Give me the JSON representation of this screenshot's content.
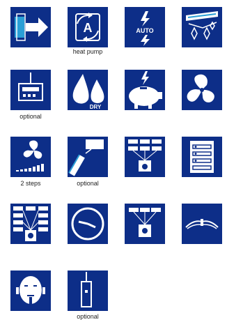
{
  "colors": {
    "tile": "#0d2e88",
    "accent": "#2a9fd6",
    "icon": "#ffffff"
  },
  "icons": [
    {
      "name": "airflow-arrow-icon",
      "caption": ""
    },
    {
      "name": "heat-pump-auto-icon",
      "caption": "heat pump",
      "text": "A"
    },
    {
      "name": "auto-lightning-icon",
      "caption": "",
      "text": "AUTO"
    },
    {
      "name": "ionizer-filter-icon",
      "caption": ""
    },
    {
      "name": "remote-control-icon",
      "caption": "optional"
    },
    {
      "name": "dry-mode-icon",
      "caption": "",
      "text": "DRY"
    },
    {
      "name": "energy-saving-piggy-icon",
      "caption": ""
    },
    {
      "name": "fan-icon",
      "caption": ""
    },
    {
      "name": "fan-speed-icon",
      "caption": "2 steps"
    },
    {
      "name": "wired-sensor-icon",
      "caption": "optional"
    },
    {
      "name": "central-control-network-icon",
      "caption": ""
    },
    {
      "name": "control-panel-list-icon",
      "caption": ""
    },
    {
      "name": "large-network-control-icon",
      "caption": ""
    },
    {
      "name": "timer-clock-icon",
      "caption": ""
    },
    {
      "name": "group-control-icon",
      "caption": ""
    },
    {
      "name": "swing-louver-icon",
      "caption": ""
    },
    {
      "name": "quiet-operation-face-icon",
      "caption": ""
    },
    {
      "name": "door-contact-icon",
      "caption": "optional"
    }
  ]
}
